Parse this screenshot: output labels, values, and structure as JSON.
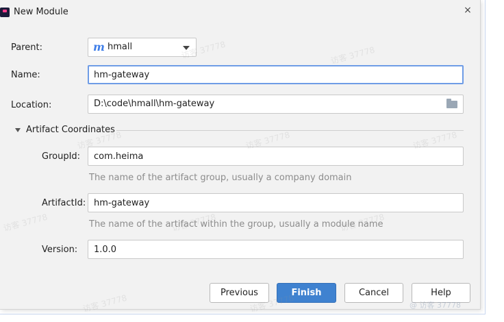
{
  "window": {
    "title": "New Module",
    "close_glyph": "×"
  },
  "parent": {
    "label": "Parent:",
    "value": "hmall",
    "icon": "m"
  },
  "name": {
    "label": "Name:",
    "value": "hm-gateway"
  },
  "location": {
    "label": "Location:",
    "value": "D:\\code\\hmall\\hm-gateway"
  },
  "artifact": {
    "section_label": "Artifact Coordinates",
    "group_id": {
      "label": "GroupId:",
      "value": "com.heima",
      "hint": "The name of the artifact group, usually a company domain"
    },
    "artifact_id": {
      "label": "ArtifactId:",
      "value": "hm-gateway",
      "hint": "The name of the artifact within the group, usually a module name"
    },
    "version": {
      "label": "Version:",
      "value": "1.0.0"
    }
  },
  "buttons": {
    "previous": "Previous",
    "finish": "Finish",
    "cancel": "Cancel",
    "help": "Help"
  },
  "watermarks": {
    "text": "访客 37778",
    "corner": "@ 访客 37778"
  },
  "colors": {
    "focus_border": "#6e9ce6",
    "primary_button": "#3f82d0",
    "hint_text": "#8c8c8c",
    "brand_icon": "#3f7ee8"
  }
}
